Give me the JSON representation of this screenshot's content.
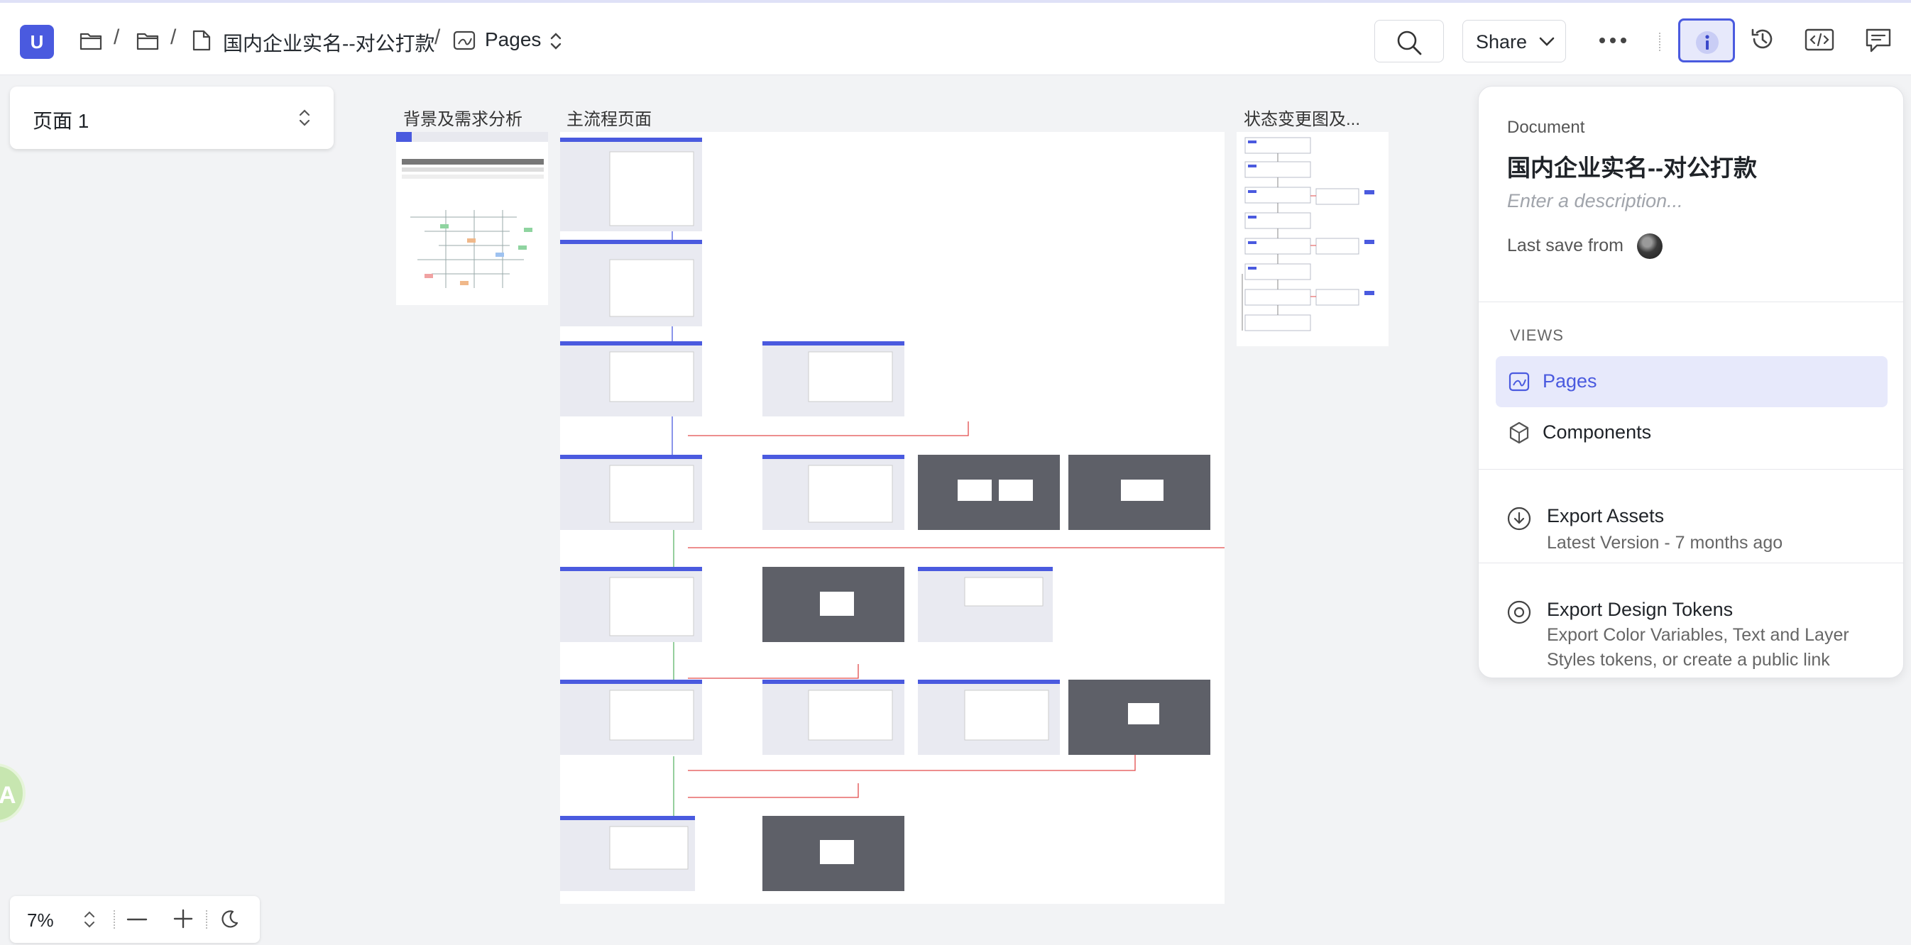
{
  "app": {
    "logo_letter": "U"
  },
  "breadcrumb": {
    "doc_name": "国内企业实名--对公打款",
    "separator": "/",
    "current": "Pages"
  },
  "toolbar": {
    "share_label": "Share"
  },
  "page_selector": {
    "current": "页面 1"
  },
  "canvas": {
    "frames": [
      {
        "title": "背景及需求分析"
      },
      {
        "title": "主流程页面"
      },
      {
        "title": "状态变更图及..."
      }
    ]
  },
  "info_panel": {
    "section_label": "Document",
    "doc_title": "国内企业实名--对公打款",
    "description_placeholder": "Enter a description...",
    "last_save_label": "Last save from",
    "views_label": "VIEWS",
    "views": [
      {
        "label": "Pages",
        "active": true
      },
      {
        "label": "Components",
        "active": false
      }
    ],
    "export_assets": {
      "title": "Export Assets",
      "subtitle": "Latest Version - 7 months ago"
    },
    "export_tokens": {
      "title": "Export Design Tokens",
      "subtitle": "Export Color Variables, Text and Layer Styles tokens, or create a public link"
    }
  },
  "zoom": {
    "value": "7%"
  },
  "colors": {
    "accent": "#4a5adf",
    "active_bg": "#e7e9fb",
    "canvas_bg": "#f2f3f5"
  },
  "icons": [
    "folder-icon",
    "page-icon",
    "pages-icon",
    "search-icon",
    "chevron-down-icon",
    "more-icon",
    "info-icon",
    "history-icon",
    "code-icon",
    "comment-icon",
    "components-icon",
    "download-icon",
    "tokens-icon",
    "moon-icon"
  ]
}
